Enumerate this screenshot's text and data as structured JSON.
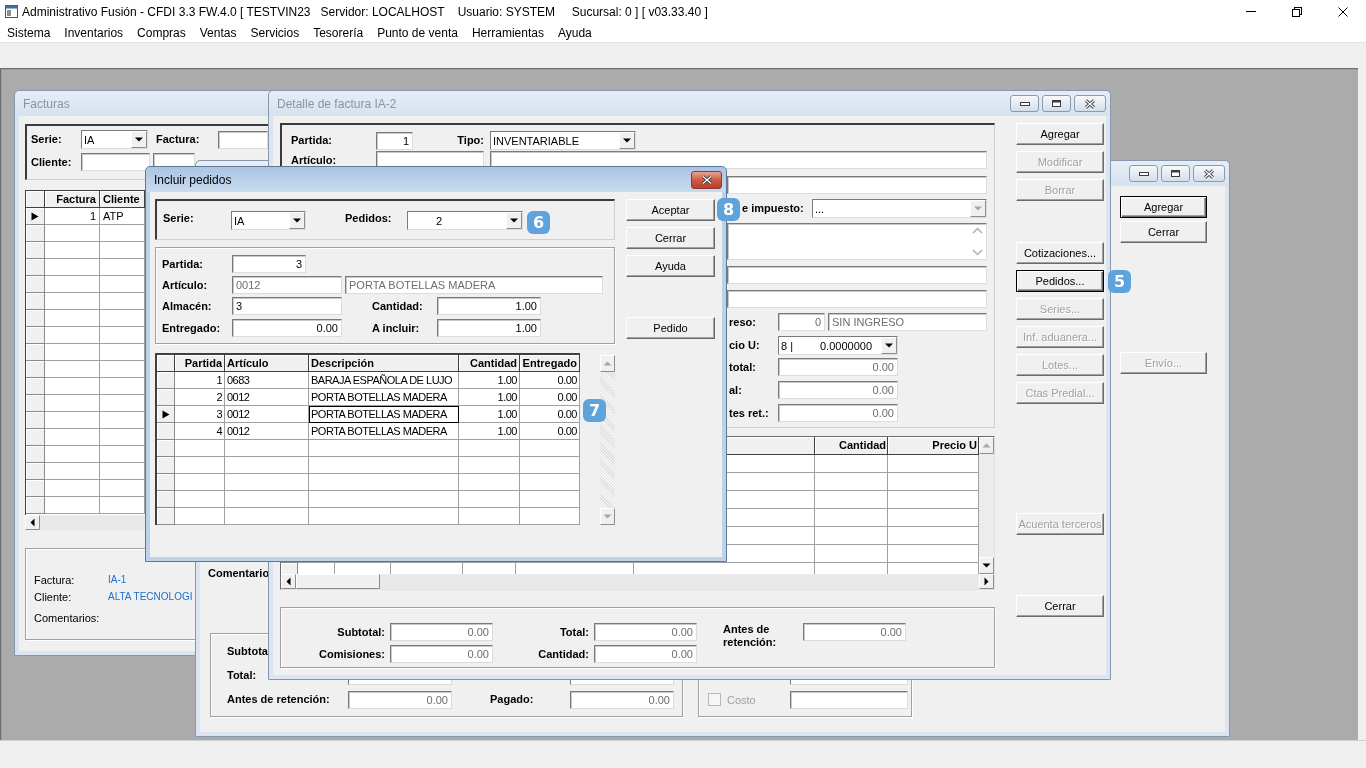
{
  "app": {
    "title": "Administrativo Fusión - CFDI 3.3 FW.4.0 [ TESTVIN23   Servidor: LOCALHOST    Usuario: SYSTEM     Sucursal: 0 ] [ v03.33.40 ]",
    "menu": [
      "Sistema",
      "Inventarios",
      "Compras",
      "Ventas",
      "Servicios",
      "Tesorería",
      "Punto de venta",
      "Herramientas",
      "Ayuda"
    ]
  },
  "facturas": {
    "title": "Facturas",
    "active": false,
    "serie": {
      "label": "Serie:",
      "value": "IA"
    },
    "factura": {
      "label": "Factura:"
    },
    "cliente": {
      "label": "Cliente:"
    },
    "grid": {
      "columns": [
        {
          "label": "Factura"
        },
        {
          "label": "Cliente"
        }
      ],
      "rows": [
        {
          "cells": [
            "1",
            "ATP"
          ],
          "selected": true
        }
      ]
    },
    "summary": [
      {
        "label": "Factura:",
        "value": "IA-1"
      },
      {
        "label": "Cliente:",
        "value": "ALTA TECNOLOGI"
      },
      {
        "label": "Comentarios:"
      }
    ]
  },
  "background_window": {
    "active": false,
    "comments_label": "Comentario",
    "totals": {
      "subtotal": {
        "label": "Subtota"
      },
      "total": {
        "label": "Total:"
      },
      "antes": {
        "label": "Antes de retención:",
        "value": "0.00",
        "disabled": true
      },
      "pagado": {
        "label": "Pagado:",
        "value": "0.00",
        "disabled": true
      }
    },
    "options": [
      {
        "label": "Costo",
        "checked": false,
        "disabled": true
      }
    ],
    "buttons": [
      {
        "label": "Agregar",
        "disabled": false,
        "default": true
      },
      {
        "label": "Cerrar",
        "disabled": false,
        "default": false
      }
    ],
    "lower_buttons": [
      {
        "label": "Envío...",
        "disabled": true,
        "default": false
      }
    ]
  },
  "detalle": {
    "title": "Detalle de factura IA-2",
    "active": false,
    "partida": {
      "label": "Partida:",
      "value": "1"
    },
    "tipo": {
      "label": "Tipo:",
      "value": "INVENTARIABLE"
    },
    "articulo": {
      "label": "Artículo:"
    },
    "impuesto": {
      "label": "e impuesto:",
      "value": "...",
      "disabled": true
    },
    "ingreso": {
      "label": "reso:",
      "code": "0",
      "description": "SIN INGRESO",
      "disabled": true
    },
    "precio": {
      "label": "cio U:",
      "list": "8 |",
      "value": "0.0000000"
    },
    "amounts": [
      {
        "label": "total:",
        "value": "0.00",
        "disabled": true
      },
      {
        "label": "al:",
        "value": "0.00",
        "disabled": true
      },
      {
        "label": "tes ret.:",
        "value": "0.00",
        "disabled": true
      }
    ],
    "grid": {
      "columns": [
        "Cantidad",
        "Precio U"
      ]
    },
    "totals": {
      "subtotal": {
        "label": "Subtotal:",
        "value": "0.00",
        "disabled": true
      },
      "total": {
        "label": "Total:",
        "value": "0.00",
        "disabled": true
      },
      "antes": {
        "label": "Antes de retención:",
        "value": "0.00",
        "disabled": true
      },
      "comisiones": {
        "label": "Comisiones:",
        "value": "0.00",
        "disabled": true
      },
      "cantidad": {
        "label": "Cantidad:",
        "value": "0.00",
        "disabled": true
      }
    },
    "button_groups": [
      [
        {
          "label": "Agregar",
          "disabled": false,
          "default": false
        },
        {
          "label": "Modificar",
          "disabled": true,
          "default": false
        },
        {
          "label": "Borrar",
          "disabled": true,
          "default": false
        }
      ],
      [
        {
          "label": "Cotizaciones...",
          "disabled": false,
          "default": false
        },
        {
          "label": "Pedidos...",
          "disabled": false,
          "default": true,
          "callout": "5"
        },
        {
          "label": "Series...",
          "disabled": true,
          "default": false
        },
        {
          "label": "Inf. aduanera...",
          "disabled": true,
          "default": false
        },
        {
          "label": "Lotes...",
          "disabled": true,
          "default": false
        },
        {
          "label": "Ctas Predial...",
          "disabled": true,
          "default": false
        }
      ],
      [
        {
          "label": "Acuenta terceros",
          "disabled": true,
          "default": false
        }
      ],
      [
        {
          "label": "Cerrar",
          "disabled": false,
          "default": false
        }
      ]
    ]
  },
  "incluir_pedidos": {
    "title": "Incluir pedidos",
    "active": true,
    "serie": {
      "label": "Serie:",
      "value": "IA"
    },
    "pedidos": {
      "label": "Pedidos:",
      "value": "2",
      "callout": "6"
    },
    "partida": {
      "label": "Partida:",
      "value": "3",
      "disabled": false
    },
    "articulo": {
      "label": "Artículo:",
      "code": "0012",
      "description": "PORTA BOTELLAS MADERA",
      "disabled": true
    },
    "almacen": {
      "label": "Almacén:",
      "value": "3",
      "disabled": false
    },
    "cantidad": {
      "label": "Cantidad:",
      "value": "1.00",
      "disabled": false
    },
    "entregado": {
      "label": "Entregado:",
      "value": "0.00",
      "disabled": false
    },
    "a_incluir": {
      "label": "A incluir:",
      "value": "1.00",
      "disabled": false
    },
    "grid": {
      "callout": "7",
      "columns": [
        {
          "label": "Partida",
          "focused": false
        },
        {
          "label": "Artículo",
          "focused": false
        },
        {
          "label": "Descripción",
          "focused": true
        },
        {
          "label": "Cantidad",
          "focused": false
        },
        {
          "label": "Entregado",
          "focused": false
        }
      ],
      "rows": [
        {
          "cells": [
            "1",
            "0683",
            "BARAJA ESPAÑOLA DE LUJO",
            "1.00",
            "0.00"
          ],
          "selected": false
        },
        {
          "cells": [
            "2",
            "0012",
            "PORTA BOTELLAS MADERA",
            "1.00",
            "0.00"
          ],
          "selected": false
        },
        {
          "cells": [
            "3",
            "0012",
            "PORTA BOTELLAS MADERA",
            "1.00",
            "0.00"
          ],
          "selected": true
        },
        {
          "cells": [
            "4",
            "0012",
            "PORTA BOTELLAS MADERA",
            "1.00",
            "0.00"
          ],
          "selected": false
        }
      ]
    },
    "button_groups": [
      [
        {
          "label": "Aceptar",
          "disabled": false,
          "default": false,
          "callout": "8"
        },
        {
          "label": "Cerrar",
          "disabled": false,
          "default": false
        },
        {
          "label": "Ayuda",
          "disabled": false,
          "default": false
        }
      ],
      [
        {
          "label": "Pedido",
          "disabled": false,
          "default": false
        }
      ]
    ]
  }
}
